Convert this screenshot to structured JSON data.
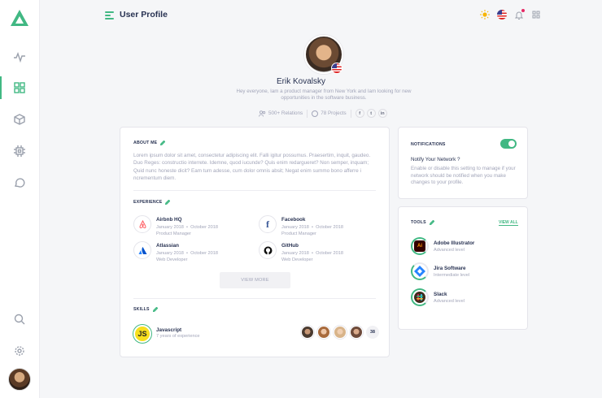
{
  "header": {
    "title": "User Profile"
  },
  "profile": {
    "name": "Erik Kovalsky",
    "bio": "Hey everyone,  Iam a product manager from New York and Iam looking for new opportunities in the software business.",
    "relations": "500+ Relations",
    "projects": "78 Projects",
    "social": [
      "f",
      "t",
      "in"
    ]
  },
  "about": {
    "title": "ABOUT ME",
    "text": "Lorem ipsum dolor sit amet, consectetur adipiscing elit. Falli igitur possumus. Praesertim, inquit, gaudeo. Duo Reges: constructio interrete. Idemne, quod iucunde? Quis enim redargueret? Non semper, inquam; Quid nunc honeste dicit? Eam tum adesse, cum dolor omnis absit; Negat enim summo bono afferre i ncrementum diem."
  },
  "experience": {
    "title": "EXPERIENCE",
    "items": [
      {
        "company": "Airbnb HQ",
        "start": "January 2018",
        "end": "October 2018",
        "role": "Product Manager",
        "icon": "airbnb-icon"
      },
      {
        "company": "Facebook",
        "start": "January 2018",
        "end": "October 2018",
        "role": "Product Manager",
        "icon": "facebook-icon"
      },
      {
        "company": "Atlassian",
        "start": "January 2018",
        "end": "October 2018",
        "role": "Web Developer",
        "icon": "atlassian-icon"
      },
      {
        "company": "GitHub",
        "start": "January 2018",
        "end": "October 2018",
        "role": "Web Developer",
        "icon": "github-icon"
      }
    ],
    "view_more": "VIEW MORE"
  },
  "skills": {
    "title": "SKILLS",
    "name": "Javascript",
    "badge": "JS",
    "experience": "7 years of experience",
    "more_count": "38"
  },
  "notifications": {
    "title": "NOTIFICATIONS",
    "enabled": true,
    "question": "Notify Your Network ?",
    "description": "Enable or disable this setting to manage if your network should be notified when you make changes to your profile."
  },
  "tools": {
    "title": "TOOLS",
    "view_all": "VIEW ALL",
    "items": [
      {
        "name": "Adobe Illustrator",
        "level": "Advanced level",
        "badge": "Ai",
        "progress": 0.85
      },
      {
        "name": "Jira Software",
        "level": "Intermediate level",
        "badge": "",
        "progress": 0.6
      },
      {
        "name": "Slack",
        "level": "Advanced level",
        "badge": "",
        "progress": 0.85
      }
    ]
  },
  "colors": {
    "accent": "#41b883",
    "text": "#283252",
    "muted": "#a2a5b9"
  }
}
